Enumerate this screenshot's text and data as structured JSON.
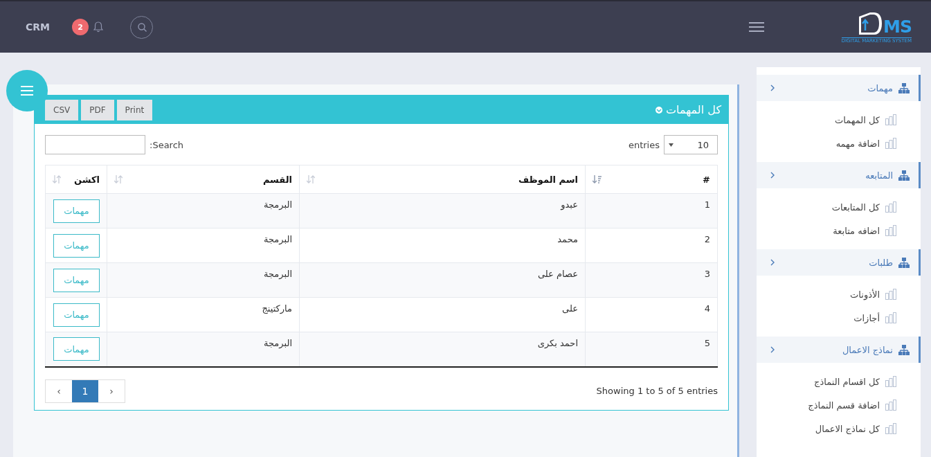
{
  "topbar": {
    "brand": "CRM",
    "notifications": "2",
    "logo_text": "MS",
    "logo_tagline": "DIGITAL MARKETING SYSTEM"
  },
  "sidebar": {
    "groups": [
      {
        "label": "مهمات",
        "expanded": true,
        "items": [
          "كل المهمات",
          "اضافة مهمه"
        ]
      },
      {
        "label": "المتابعه",
        "expanded": true,
        "items": [
          "كل المتابعات",
          "اضافه متابعة"
        ]
      },
      {
        "label": "طلبات",
        "expanded": true,
        "items": [
          "الأذونات",
          "أجازات"
        ]
      },
      {
        "label": "نماذج الاعمال",
        "expanded": true,
        "items": [
          "كل اقسام النماذج",
          "اضافة قسم النماذج",
          "كل نماذج الاعمال"
        ]
      }
    ]
  },
  "panel": {
    "title": "كل المهمات",
    "export_buttons": [
      "Print",
      "PDF",
      "CSV"
    ],
    "length": {
      "value": "10",
      "label": "entries"
    },
    "search": {
      "label": "Search:"
    },
    "table": {
      "columns": [
        {
          "label": "#",
          "sorted": true
        },
        {
          "label": "اسم الموظف",
          "sorted": false
        },
        {
          "label": "القسم",
          "sorted": false
        },
        {
          "label": "اكشن",
          "sorted": false
        }
      ],
      "rows": [
        {
          "cells": [
            "1",
            "عبدو",
            "البرمجة"
          ],
          "action": "مهمات"
        },
        {
          "cells": [
            "2",
            "محمد",
            "البرمجة"
          ],
          "action": "مهمات"
        },
        {
          "cells": [
            "3",
            "عصام على",
            "البرمجة"
          ],
          "action": "مهمات"
        },
        {
          "cells": [
            "4",
            "على",
            "ماركتينج"
          ],
          "action": "مهمات"
        },
        {
          "cells": [
            "5",
            "احمد بكرى",
            "البرمجة"
          ],
          "action": "مهمات"
        }
      ]
    },
    "info": "Showing 1 to 5 of 5 entries",
    "pagination": {
      "prev": "‹",
      "next": "›",
      "pages": [
        {
          "label": "1",
          "selected": true
        }
      ]
    }
  }
}
